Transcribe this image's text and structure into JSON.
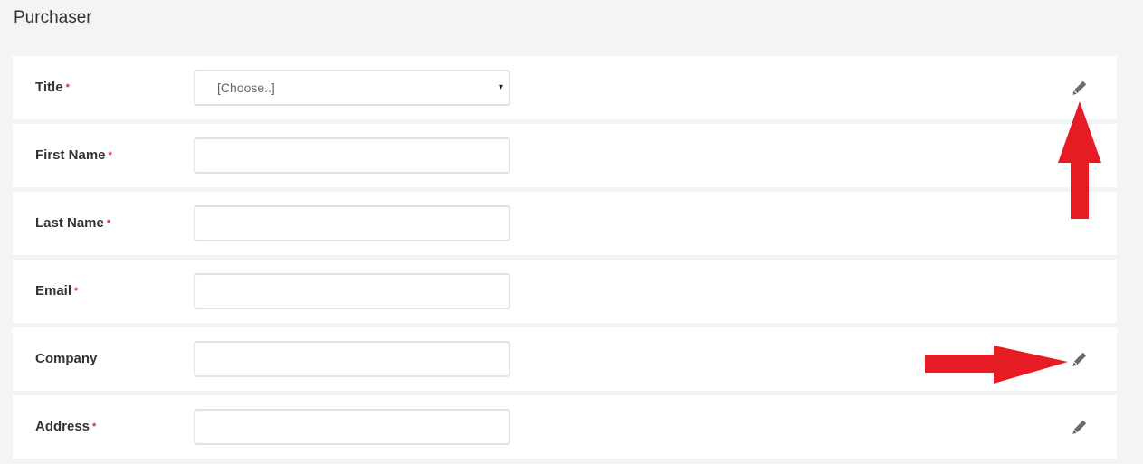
{
  "section": {
    "title": "Purchaser"
  },
  "fields": {
    "title": {
      "label": "Title",
      "required_mark": "*",
      "selected_value": "[Choose..]",
      "arrow": "▾"
    },
    "first_name": {
      "label": "First Name",
      "required_mark": "*",
      "value": ""
    },
    "last_name": {
      "label": "Last Name",
      "required_mark": "*",
      "value": ""
    },
    "email": {
      "label": "Email",
      "required_mark": "*",
      "value": ""
    },
    "company": {
      "label": "Company",
      "value": ""
    },
    "address": {
      "label": "Address",
      "required_mark": "*",
      "value": ""
    }
  },
  "icons": {
    "edit": "pencil-icon"
  },
  "colors": {
    "required": "#d9243a",
    "annotation_arrow": "#e51c24",
    "edit_icon": "#6b6b6b",
    "page_background": "#f3f4f6",
    "row_background": "#ffffff"
  }
}
